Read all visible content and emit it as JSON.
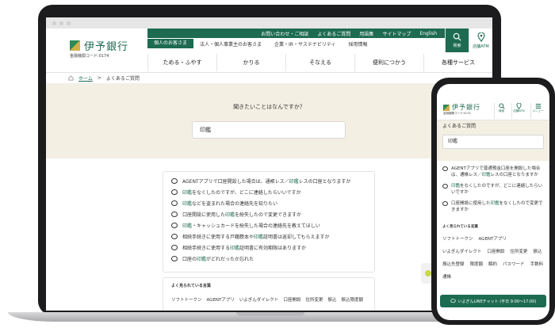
{
  "desktop": {
    "logo": "伊予銀行",
    "bank_code": "金融機関コード:0174",
    "utility_links": [
      "お問い合わせ・ご相談",
      "よくあるご質問",
      "用語集",
      "サイトマップ",
      "English"
    ],
    "segments": [
      "個人のお客さま",
      "法人・個人事業主のお客さま",
      "企業・IR・サステナビリティ",
      "採用情報"
    ],
    "icons": {
      "search": "検索",
      "atm": "店舗ATM"
    },
    "main_nav": [
      "ためる・ふやす",
      "かりる",
      "そなえる",
      "便利につかう",
      "各種サービス"
    ],
    "breadcrumb": {
      "home": "ホーム",
      "sep": ">",
      "current": "よくあるご質問"
    },
    "question": "聞きたいことはなんですか？",
    "search_value": "印鑑",
    "results": [
      {
        "pre": "AGENTアプリで口座開設した場合は、通帳レス／",
        "hl": "印鑑",
        "post": "レスの口座となりますか"
      },
      {
        "pre": "",
        "hl": "印鑑",
        "post": "をなくしたのですが、どこに連絡したらいいですか"
      },
      {
        "pre": "",
        "hl": "印鑑",
        "post": "などを盗まれた場合の連絡先を知りたい"
      },
      {
        "pre": "口座開設に使用した",
        "hl": "印鑑",
        "post": "を紛失したので変更できますか"
      },
      {
        "pre": "",
        "hl": "印鑑",
        "post": "・キャッシュカードを紛失した場合の連絡先を教えてほしい"
      },
      {
        "pre": "相続手続きに使用する戸籍謄本や",
        "hl": "印鑑",
        "post": "証明書は返却してもらえますか"
      },
      {
        "pre": "相続手続きに使用する",
        "hl": "印鑑",
        "post": "証明書に有効期限はありますか"
      },
      {
        "pre": "口座の",
        "hl": "印鑑",
        "post": "がどれだったか忘れた"
      }
    ],
    "popular_title": "よく見られている言葉",
    "popular_tags": [
      "ソフトトークン",
      "AGENTアプリ",
      "いよぎんダイレクト",
      "口座開設",
      "住所変更",
      "振込",
      "振込限度額"
    ]
  },
  "mobile": {
    "logo": "伊予銀行",
    "bank_code": "金融機関コード:0174",
    "icons": {
      "search": "検索",
      "atm": "店舗ATM",
      "menu": "メニュー"
    },
    "title": "よくあるご質問",
    "search_value": "印鑑",
    "results": [
      {
        "pre": "AGENTアプリで普通預金口座を開設した場合は、通帳レス／",
        "hl": "印鑑",
        "post": "レスの口座となりますか"
      },
      {
        "pre": "",
        "hl": "印鑑",
        "post": "をなくしたのですが、どこに連絡したらいいですか"
      },
      {
        "pre": "口座開設に使用した",
        "hl": "印鑑",
        "post": "をなくしたので変更できますか"
      }
    ],
    "popular_title": "よく見られている言葉",
    "popular_tags": [
      "ソフトトークン",
      "AGENTアプリ",
      "いよぎんダイレクト",
      "口座開設",
      "住所変更",
      "振込",
      "振込先登録",
      "限度額",
      "解約",
      "パスワード",
      "手数料",
      "通帳"
    ],
    "line_chat": "いよぎんLINEチャット (平日 9:00〜17:00)"
  },
  "colors": {
    "brand_green": "#1d6b50",
    "beige": "#f4efe3"
  }
}
